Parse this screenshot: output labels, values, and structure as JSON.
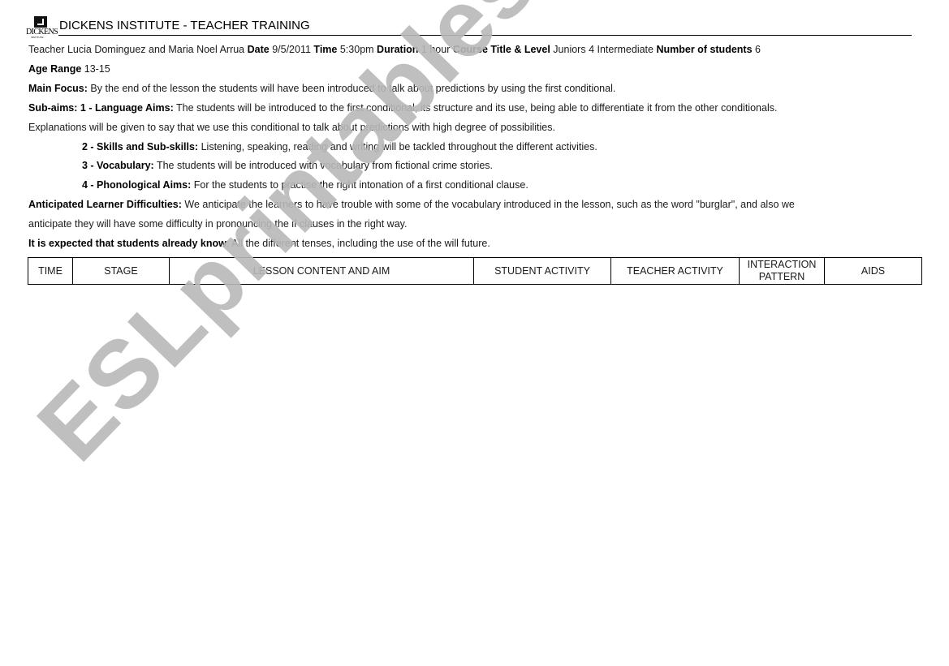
{
  "header": {
    "logo_text": "DICKENS",
    "logo_subtext": "INSTITUTE",
    "title": "DICKENS INSTITUTE - TEACHER TRAINING"
  },
  "info": {
    "teacher_label": "Teacher",
    "teacher_value": "Lucia Dominguez and Maria Noel Arrua",
    "date_label": "Date",
    "date_value": "9/5/2011",
    "time_label": "Time",
    "time_value": "5:30pm",
    "duration_label": "Duration",
    "duration_value": "1 hour",
    "course_label": "Course Title & Level",
    "course_value": "Juniors 4 Intermediate",
    "students_label": "Number of students",
    "students_value": "6",
    "age_label": "Age Range",
    "age_value": "13-15"
  },
  "main_focus": {
    "label": "Main Focus:",
    "text": "By the end of the lesson the students will have been introduced to talk about predictions by using the first conditional."
  },
  "sub_aims": {
    "label": "Sub-aims: 1 - Language Aims:",
    "text": "The students will be introduced to the first conditional, its structure and its use, being able to differentiate it from the other conditionals.",
    "continuation": "Explanations will be given to say that we use this conditional to talk about predictions with high degree of possibilities.",
    "items": [
      {
        "label": "2 - Skills and Sub-skills:",
        "text": "Listening, speaking, reading and writing will be tackled throughout the different activities."
      },
      {
        "label": "3 - Vocabulary:",
        "text": "The students will be introduced with vocabulary from fictional crime stories."
      },
      {
        "label": "4 - Phonological Aims:",
        "text": "For the students to practise the right intonation of a first conditional clause."
      }
    ]
  },
  "difficulties": {
    "label": "Anticipated Learner Difficulties:",
    "text": "We anticipate the learners to have trouble with some of the vocabulary introduced in the lesson, such as the word \"burglar\", and also we",
    "continuation": "anticipate they will have some difficulty in pronouncing the if clauses in the right way."
  },
  "prior_knowledge": {
    "label": "It is expected that students already know",
    "text": ": All the different tenses, including the use of the will future."
  },
  "table": {
    "headers": [
      "TIME",
      "STAGE",
      "LESSON CONTENT AND AIM",
      "STUDENT ACTIVITY",
      "TEACHER ACTIVITY",
      "INTERACTION PATTERN",
      "AIDS"
    ]
  },
  "watermark": "ESLprintables.com"
}
